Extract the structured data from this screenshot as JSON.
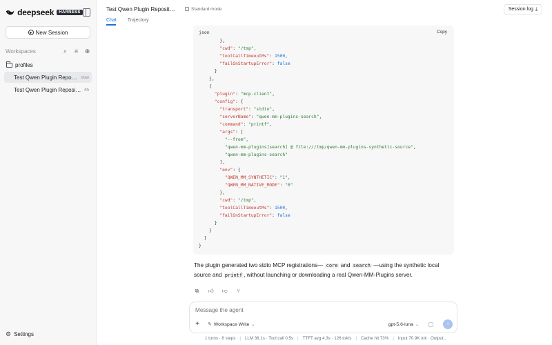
{
  "app": {
    "brand": "deepseek",
    "badge": "HARNESS"
  },
  "sidebar": {
    "new_session": "New Session",
    "workspaces_title": "Workspaces",
    "folder": "profiles",
    "sessions": [
      {
        "title": "Test Qwen Plugin Repository I...",
        "time": "now"
      },
      {
        "title": "Test Qwen Plugin Repository ...",
        "time": "4h"
      }
    ],
    "settings": "Settings"
  },
  "header": {
    "session_title": "Test Qwen Plugin Repository I...",
    "mode": "Standard mode",
    "session_log": "Session log",
    "tabs": [
      {
        "label": "Chat"
      },
      {
        "label": "Trajectory"
      }
    ]
  },
  "code_block": {
    "language": "json",
    "copy_label": "Copy"
  },
  "answer": {
    "part1": "The plugin generated two stdio MCP registrations— ",
    "code1": "core",
    "part2": " and ",
    "code2": "search",
    "part3": " —using the synthetic local source and ",
    "code3": "printf",
    "part4": ", without launching or downloading a real Qwen-MM-Plugins server."
  },
  "composer": {
    "placeholder": "Message the agent",
    "workspace_mode": "Workspace Write",
    "model": "gpt-5.6-luna"
  },
  "status_bar": [
    "1 turns · 6 steps",
    "LLM 38.1s · Tool call 0.5s",
    "TTFT avg 4.3s · 126 tok/s",
    "Cache hit 73%",
    "Input 70.9K tok · Output..."
  ],
  "icons": {
    "brand_logo": "whale-icon",
    "send": "arrow-up-icon"
  },
  "colors": {
    "accent": "#1d6fd8",
    "json_key": "#c0392b",
    "json_string": "#2f7d32",
    "json_number": "#1d6fd8"
  }
}
